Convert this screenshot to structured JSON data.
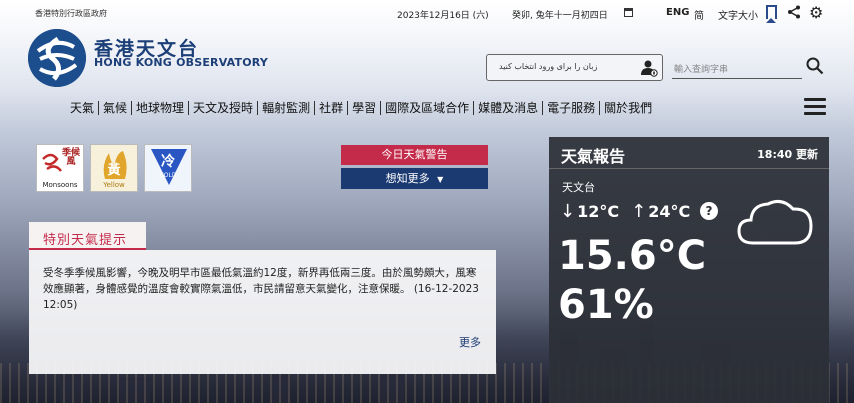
{
  "topbar": {
    "gov_label": "香港特別行政區政府",
    "date": "2023年12月16日 (六)",
    "lunar_date": "癸卯, 兔年十一月初四日",
    "lang_eng": "ENG",
    "lang_sc": "简",
    "font_size": "文字大小"
  },
  "logo": {
    "name_cn": "香港天文台",
    "name_en": "HONG KONG OBSERVATORY"
  },
  "voice_search": {
    "text": "زبان را برای ورود انتخاب کنید"
  },
  "search": {
    "placeholder": "輸入查詢字串"
  },
  "nav": {
    "items": [
      "天氣",
      "氣候",
      "地球物理",
      "天文及授時",
      "輻射監測",
      "社群",
      "學習",
      "國際及區域合作",
      "媒體及消息",
      "電子服務",
      "關於我們"
    ]
  },
  "warnings": [
    {
      "cn": "季候風",
      "label": "Monsoons"
    },
    {
      "cn": "黃",
      "label": "Yellow"
    },
    {
      "cn": "冷",
      "label": "COLD"
    }
  ],
  "buttons": {
    "today_warnings": "今日天氣警告",
    "learn_more": "想知更多"
  },
  "special_tips": {
    "title": "特別天氣提示",
    "text": "受冬季季候風影響，今晚及明早市區最低氣溫約12度，新界再低兩三度。由於風勢頗大，風寒效應顯著，身體感覺的溫度會較實際氣溫低，市民請留意天氣變化，注意保暖。 (16-12-2023 12:05)",
    "more": "更多"
  },
  "weather": {
    "title": "天氣報告",
    "update_time": "18:40 更新",
    "station": "天文台",
    "min_temp": "12°C",
    "max_temp": "24°C",
    "temperature": "15.6°C",
    "humidity": "61%",
    "icon": "cloud-icon"
  },
  "colors": {
    "brand_blue": "#1c3f78",
    "warning_red": "#c42a4a",
    "card_bg": "#2c2f37"
  }
}
